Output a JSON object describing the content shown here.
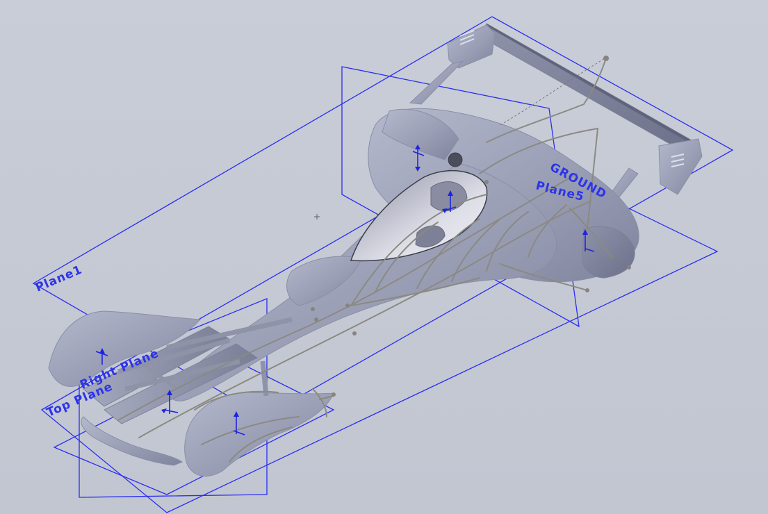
{
  "viewport": {
    "background_color": "#c5c9d4",
    "model_color": "#9da1b8",
    "plane_color": "#2a2df0",
    "sketch_color": "#8a8a82"
  },
  "planes": {
    "plane1": "Plane1",
    "right_plane": "Right Plane",
    "top_plane": "Top Plane",
    "ground": "GROUND",
    "plane5": "Plane5"
  }
}
